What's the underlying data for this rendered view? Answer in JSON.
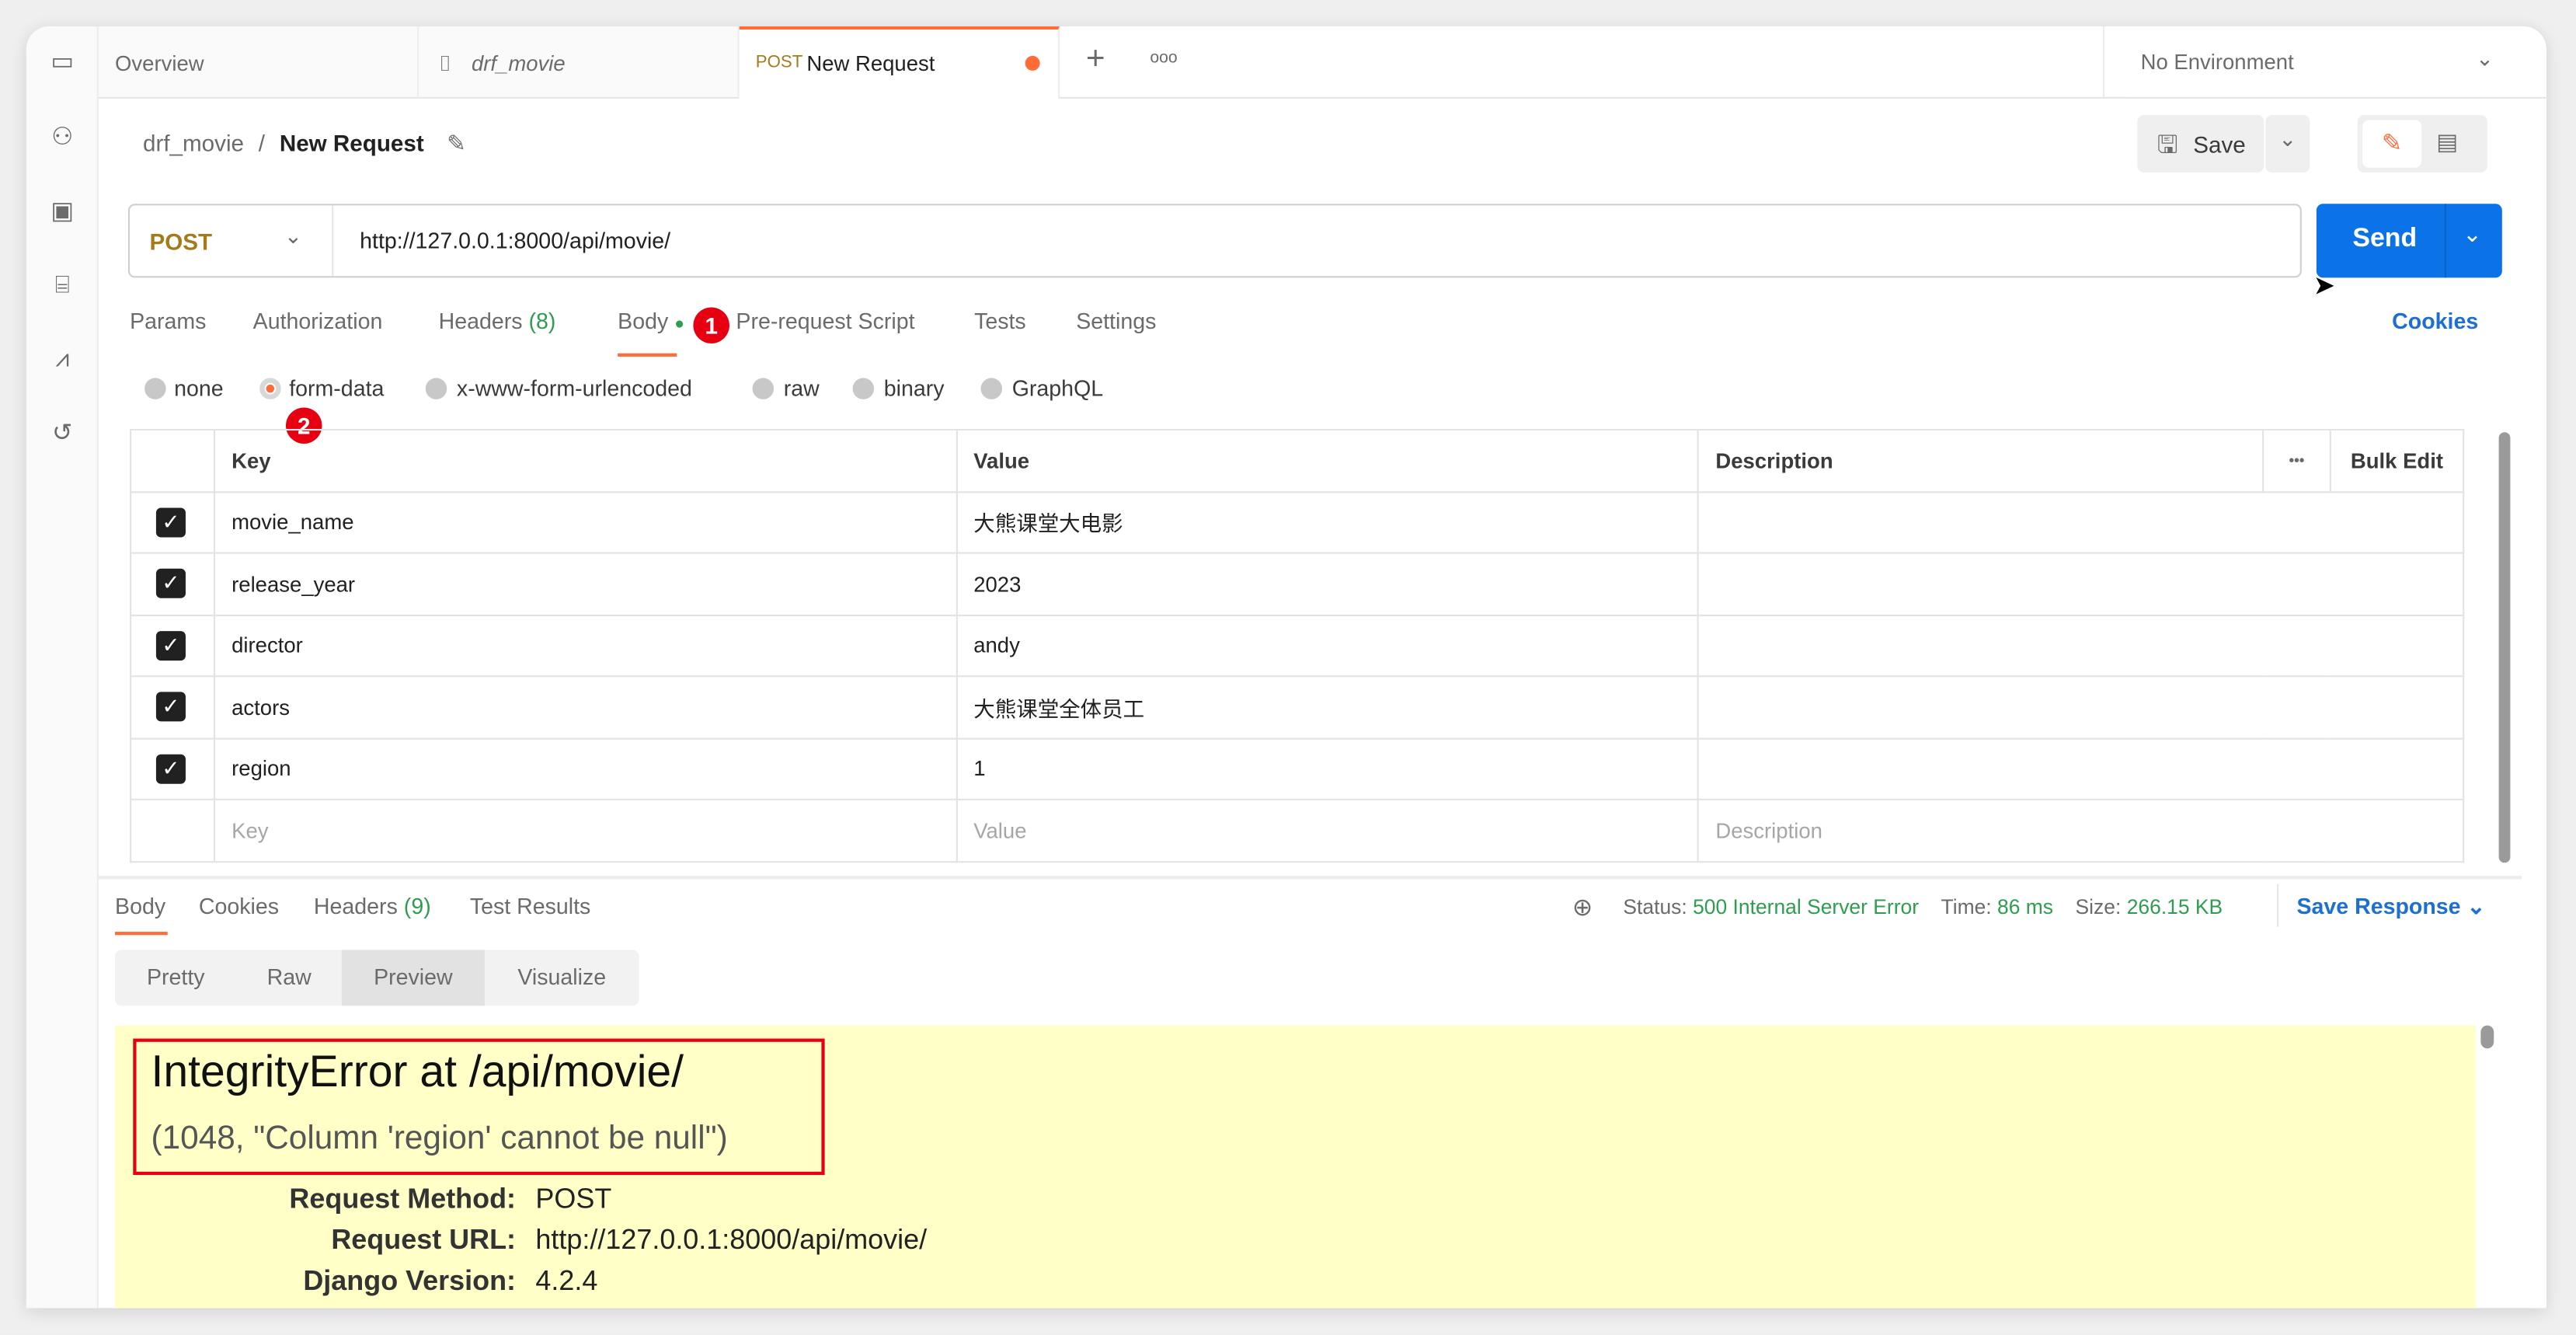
{
  "tabs": [
    {
      "label": "Overview"
    },
    {
      "label": "drf_movie",
      "icon": "collection-icon"
    },
    {
      "method": "POST",
      "label": "New Request",
      "unsaved": true
    }
  ],
  "environment": "No Environment",
  "breadcrumb": {
    "parent": "drf_movie",
    "sep": "/",
    "current": "New Request"
  },
  "toolbar": {
    "save": "Save"
  },
  "request": {
    "method": "POST",
    "url": "http://127.0.0.1:8000/api/movie/",
    "send": "Send"
  },
  "req_tabs": {
    "params": "Params",
    "authorization": "Authorization",
    "headers": "Headers",
    "headers_count": "(8)",
    "body": "Body",
    "prerequest": "Pre-request Script",
    "tests": "Tests",
    "settings": "Settings",
    "cookies": "Cookies"
  },
  "body_types": {
    "none": "none",
    "form_data": "form-data",
    "urlencoded": "x-www-form-urlencoded",
    "raw": "raw",
    "binary": "binary",
    "graphql": "GraphQL",
    "selected": "form-data"
  },
  "annotations": {
    "one": "1",
    "two": "2"
  },
  "table": {
    "headers": {
      "key": "Key",
      "value": "Value",
      "description": "Description",
      "more": "•••",
      "bulk": "Bulk Edit"
    },
    "rows": [
      {
        "key": "movie_name",
        "value": "大熊课堂大电影",
        "checked": true
      },
      {
        "key": "release_year",
        "value": "2023",
        "checked": true
      },
      {
        "key": "director",
        "value": "andy",
        "checked": true
      },
      {
        "key": "actors",
        "value": "大熊课堂全体员工",
        "checked": true
      },
      {
        "key": "region",
        "value": "1",
        "checked": true
      }
    ],
    "placeholder": {
      "key": "Key",
      "value": "Value",
      "description": "Description"
    }
  },
  "response": {
    "tabs": {
      "body": "Body",
      "cookies": "Cookies",
      "headers": "Headers",
      "headers_count": "(9)",
      "tests": "Test Results"
    },
    "status_label": "Status:",
    "status": "500 Internal Server Error",
    "time_label": "Time:",
    "time": "86 ms",
    "size_label": "Size:",
    "size": "266.15 KB",
    "save": "Save Response",
    "views": {
      "pretty": "Pretty",
      "raw": "Raw",
      "preview": "Preview",
      "visualize": "Visualize",
      "selected": "Preview"
    },
    "error_title": "IntegrityError at /api/movie/",
    "error_detail": "(1048, \"Column 'region' cannot be null\")",
    "meta": [
      {
        "label": "Request Method:",
        "value": "POST"
      },
      {
        "label": "Request URL:",
        "value": "http://127.0.0.1:8000/api/movie/"
      },
      {
        "label": "Django Version:",
        "value": "4.2.4"
      }
    ]
  },
  "colors": {
    "accent": "#ff6c37",
    "send": "#0b72e7",
    "status": "#2e9d4f",
    "link": "#1d6fd1",
    "method": "#a57a1b",
    "highlight": "#ffffc8"
  }
}
